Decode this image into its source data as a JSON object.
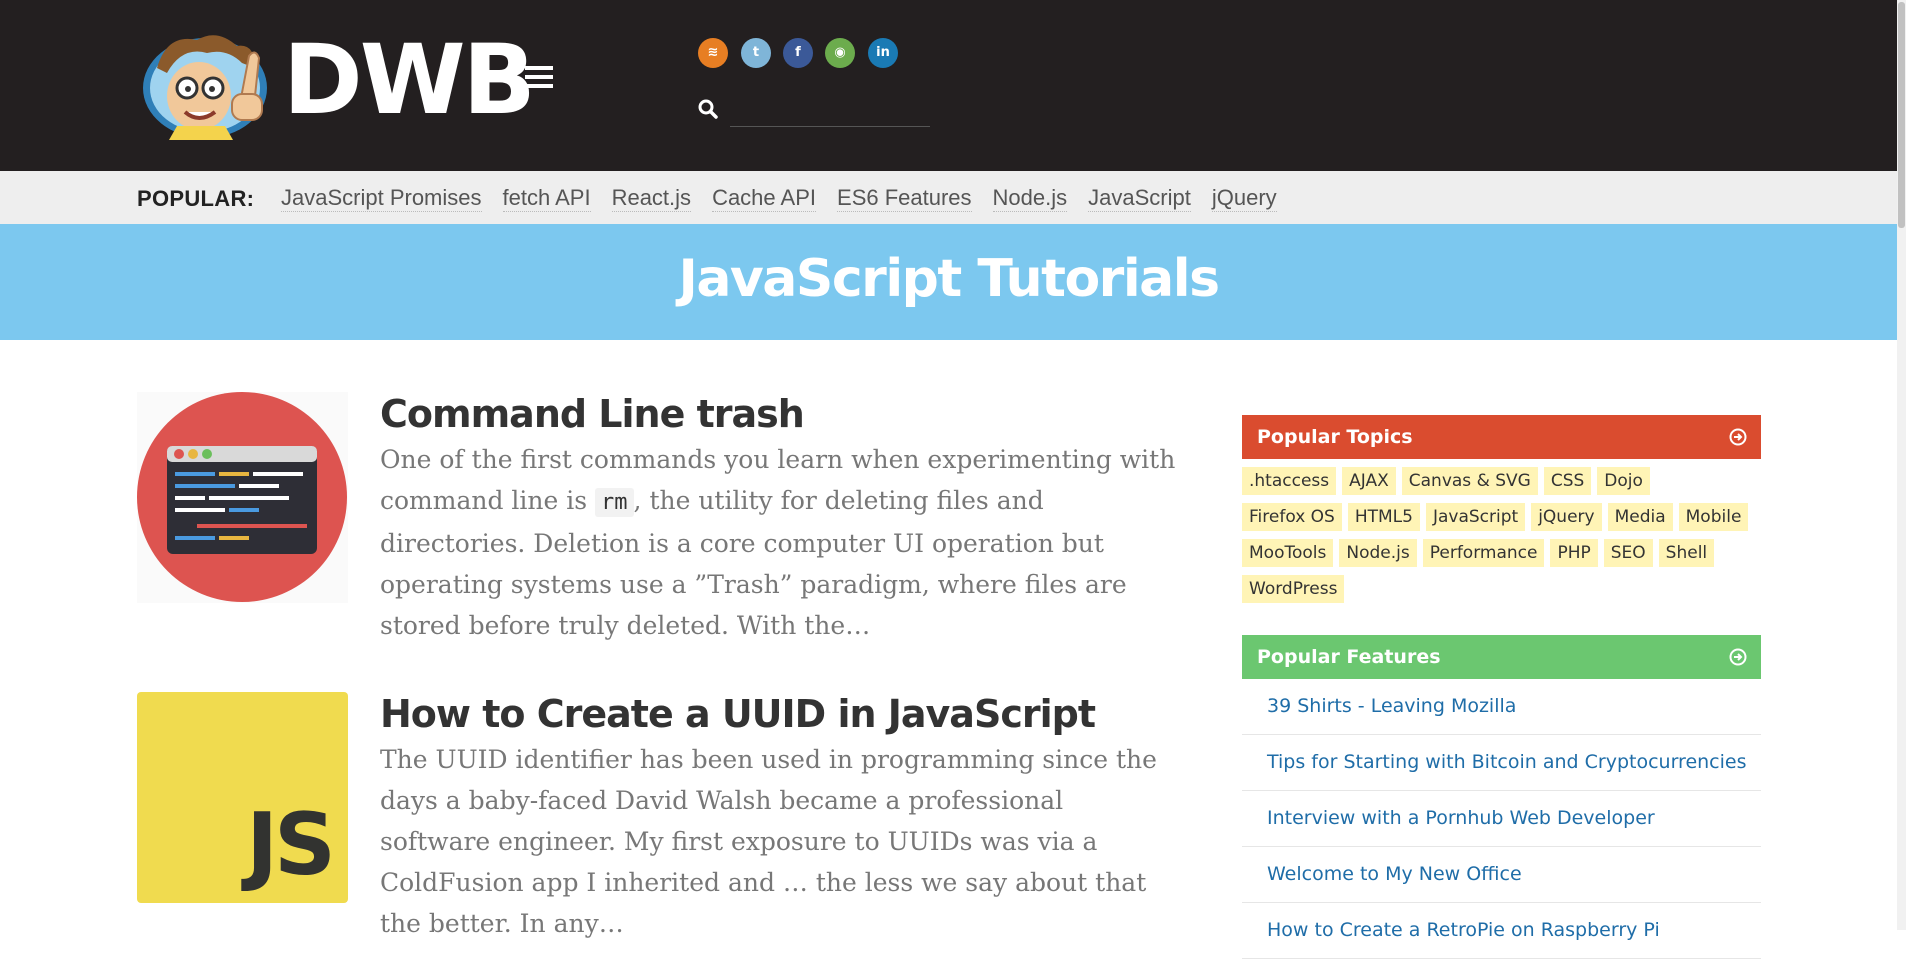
{
  "header": {
    "logo_text": "DWB",
    "search": {
      "placeholder": "",
      "value": ""
    },
    "socials": [
      {
        "name": "rss",
        "color": "#e77e23",
        "glyph": "≋"
      },
      {
        "name": "twitter",
        "color": "#7fb5d8",
        "glyph": "t"
      },
      {
        "name": "facebook",
        "color": "#3b5998",
        "glyph": "f"
      },
      {
        "name": "github",
        "color": "#6cac4d",
        "glyph": "◉"
      },
      {
        "name": "linkedin",
        "color": "#1a7ab4",
        "glyph": "in"
      }
    ]
  },
  "popular": {
    "label": "POPULAR:",
    "links": [
      "JavaScript Promises",
      "fetch API",
      "React.js",
      "Cache API",
      "ES6 Features",
      "Node.js",
      "JavaScript",
      "jQuery"
    ]
  },
  "banner": {
    "title": "JavaScript Tutorials"
  },
  "articles": [
    {
      "title": "Command Line trash",
      "excerpt_pre": "One of the first commands you learn when experimenting with command line is",
      "code": "rm",
      "excerpt_post": ", the utility for deleting files and directories. Deletion is a core computer UI operation but operating systems use a ”Trash” paradigm, where files are stored before truly deleted. With the…"
    },
    {
      "title": "How to Create a UUID in JavaScript",
      "thumb_text": "JS",
      "excerpt": "The UUID identifier has been used in programming since the days a baby-faced David Walsh became a professional software engineer. My first exposure to UUIDs was via a ColdFusion app I inherited and … the less we say about that the better. In any…"
    }
  ],
  "sidebar": {
    "topics": {
      "title": "Popular Topics",
      "color": "#da4c2f",
      "tags": [
        ".htaccess",
        "AJAX",
        "Canvas & SVG",
        "CSS",
        "Dojo",
        "Firefox OS",
        "HTML5",
        "JavaScript",
        "jQuery",
        "Media",
        "Mobile",
        "MooTools",
        "Node.js",
        "Performance",
        "PHP",
        "SEO",
        "Shell",
        "WordPress"
      ]
    },
    "features": {
      "title": "Popular Features",
      "color": "#6bc770",
      "items": [
        "39 Shirts - Leaving Mozilla",
        "Tips for Starting with Bitcoin and Cryptocurrencies",
        "Interview with a Pornhub Web Developer",
        "Welcome to My New Office",
        "How to Create a RetroPie on Raspberry Pi"
      ]
    }
  }
}
